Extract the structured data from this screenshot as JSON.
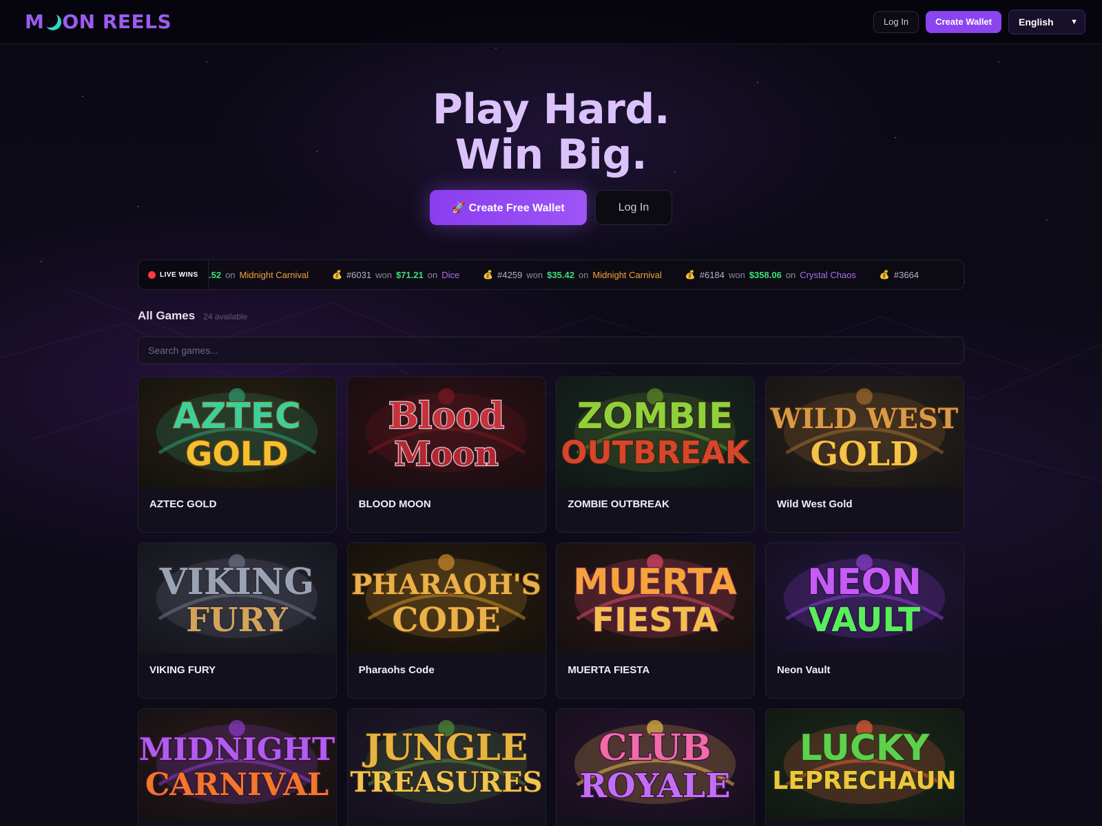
{
  "header": {
    "logo_text_left": "M",
    "logo_text_right": "ON REELS",
    "login_label": "Log In",
    "create_wallet_label": "Create Wallet",
    "language": "English"
  },
  "hero": {
    "line1": "Play Hard.",
    "line2": "Win Big.",
    "primary_label": "🚀 Create Free Wallet",
    "secondary_label": "Log In"
  },
  "ticker": {
    "label": "LIVE WINS",
    "wins": [
      {
        "user": "",
        "amount": ".52",
        "game": "Midnight Carnival",
        "game_color": "orange",
        "partial": true
      },
      {
        "user": "#6031",
        "amount": "$71.21",
        "game": "Dice",
        "game_color": "purple"
      },
      {
        "user": "#4259",
        "amount": "$35.42",
        "game": "Midnight Carnival",
        "game_color": "orange"
      },
      {
        "user": "#6184",
        "amount": "$358.06",
        "game": "Crystal Chaos",
        "game_color": "purple"
      },
      {
        "user": "#3664",
        "amount": "",
        "game": "",
        "game_color": "orange"
      }
    ],
    "won_word": "won",
    "on_word": "on"
  },
  "games": {
    "heading": "All Games",
    "count": "24 available",
    "search_placeholder": "Search games...",
    "items": [
      {
        "title": "AZTEC GOLD",
        "art_top": "AZTEC",
        "art_bottom": "GOLD",
        "theme": "aztec"
      },
      {
        "title": "BLOOD MOON",
        "art_top": "Blood",
        "art_bottom": "Moon",
        "theme": "blood"
      },
      {
        "title": "ZOMBIE OUTBREAK",
        "art_top": "ZOMBIE",
        "art_bottom": "OUTBREAK",
        "theme": "zombie"
      },
      {
        "title": "Wild West Gold",
        "art_top": "WILD WEST",
        "art_bottom": "GOLD",
        "theme": "west"
      },
      {
        "title": "VIKING FURY",
        "art_top": "VIKING",
        "art_bottom": "FURY",
        "theme": "viking"
      },
      {
        "title": "Pharaohs Code",
        "art_top": "PHARAOH'S",
        "art_bottom": "CODE",
        "theme": "pharaoh"
      },
      {
        "title": "MUERTA FIESTA",
        "art_top": "MUERTA",
        "art_bottom": "FIESTA",
        "theme": "muerta"
      },
      {
        "title": "Neon Vault",
        "art_top": "NEON",
        "art_bottom": "VAULT",
        "theme": "neon"
      },
      {
        "title": "",
        "art_top": "MIDNIGHT",
        "art_bottom": "CARNIVAL",
        "theme": "carnival"
      },
      {
        "title": "",
        "art_top": "JUNGLE",
        "art_bottom": "TREASURES",
        "theme": "jungle"
      },
      {
        "title": "",
        "art_top": "CLUB",
        "art_bottom": "ROYALE",
        "theme": "royale"
      },
      {
        "title": "",
        "art_top": "LUCKY",
        "art_bottom": "LEPRECHAUN",
        "theme": "lucky"
      }
    ]
  },
  "colors": {
    "accent": "#8b45ee",
    "win_amount": "#3ee07a",
    "game_orange": "#f6a33a",
    "game_purple": "#b06cf5",
    "hero_text": "#dcc2fb"
  }
}
